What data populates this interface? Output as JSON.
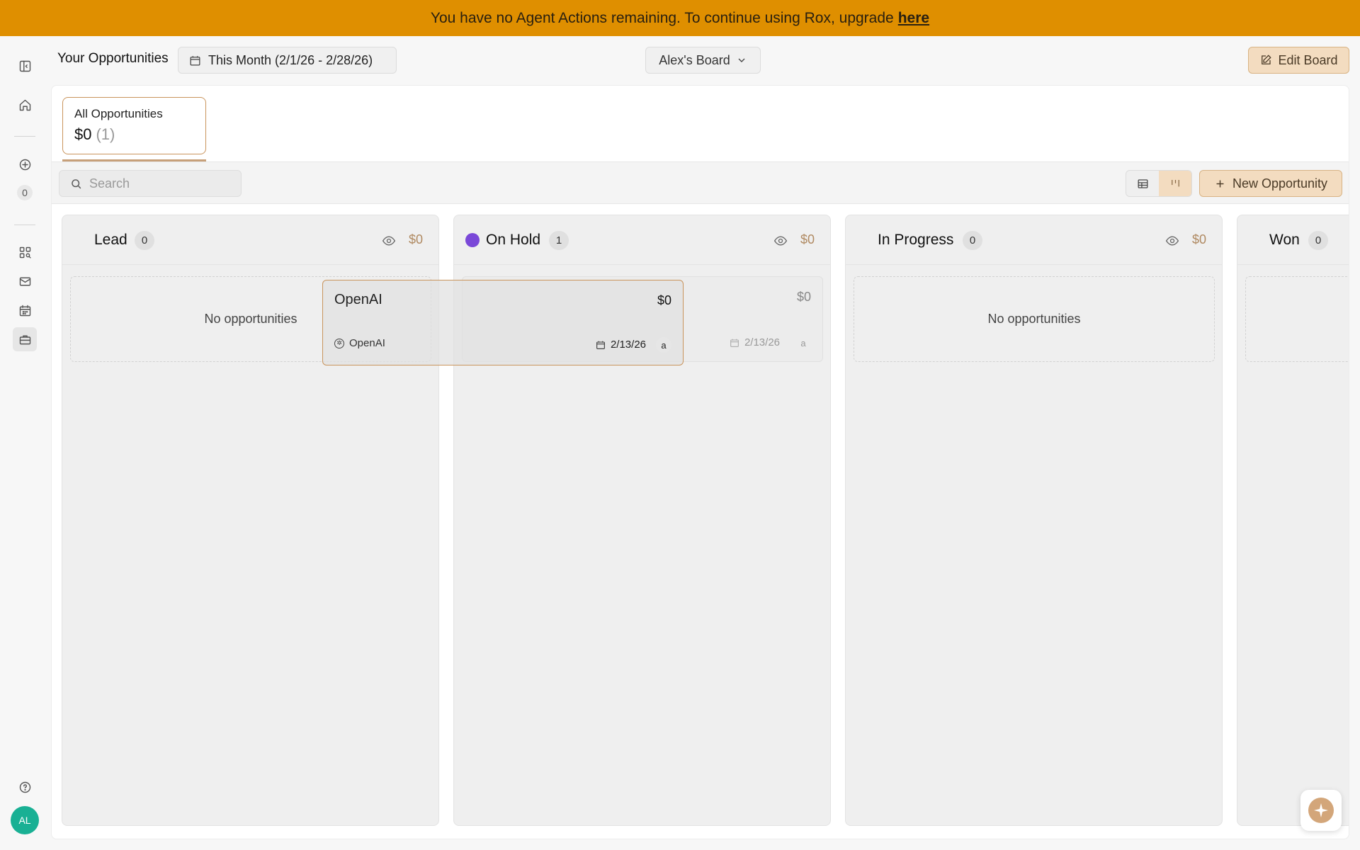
{
  "banner": {
    "message": "You have no Agent Actions remaining. To continue using Rox, upgrade",
    "link_label": "here"
  },
  "sidebar": {
    "notification_count": "0",
    "avatar_initials": "AL"
  },
  "topbar": {
    "title": "Your Opportunities",
    "date_range": "This Month (2/1/26 - 2/28/26)",
    "board_name": "Alex's Board",
    "edit_label": "Edit Board"
  },
  "summary": {
    "label": "All Opportunities",
    "amount": "$0",
    "count": "(1)"
  },
  "toolbar": {
    "search_placeholder": "Search",
    "new_label": "New Opportunity"
  },
  "columns": [
    {
      "title": "Lead",
      "count": "0",
      "sum": "$0",
      "empty": "No opportunities"
    },
    {
      "title": "On Hold",
      "count": "1",
      "sum": "$0",
      "dot_color": "#7a48d8"
    },
    {
      "title": "In Progress",
      "count": "0",
      "sum": "$0",
      "empty": "No opportunities"
    },
    {
      "title": "Won",
      "count": "0"
    }
  ],
  "ghost_card": {
    "amount": "$0",
    "date": "2/13/26",
    "user": "a"
  },
  "drag_card": {
    "title": "OpenAI",
    "amount": "$0",
    "company": "OpenAI",
    "date": "2/13/26",
    "user": "a"
  },
  "colors": {
    "banner": "#df8f00",
    "accent": "#f3dcc0",
    "accent_border": "#c9945c",
    "avatar": "#19b094"
  }
}
